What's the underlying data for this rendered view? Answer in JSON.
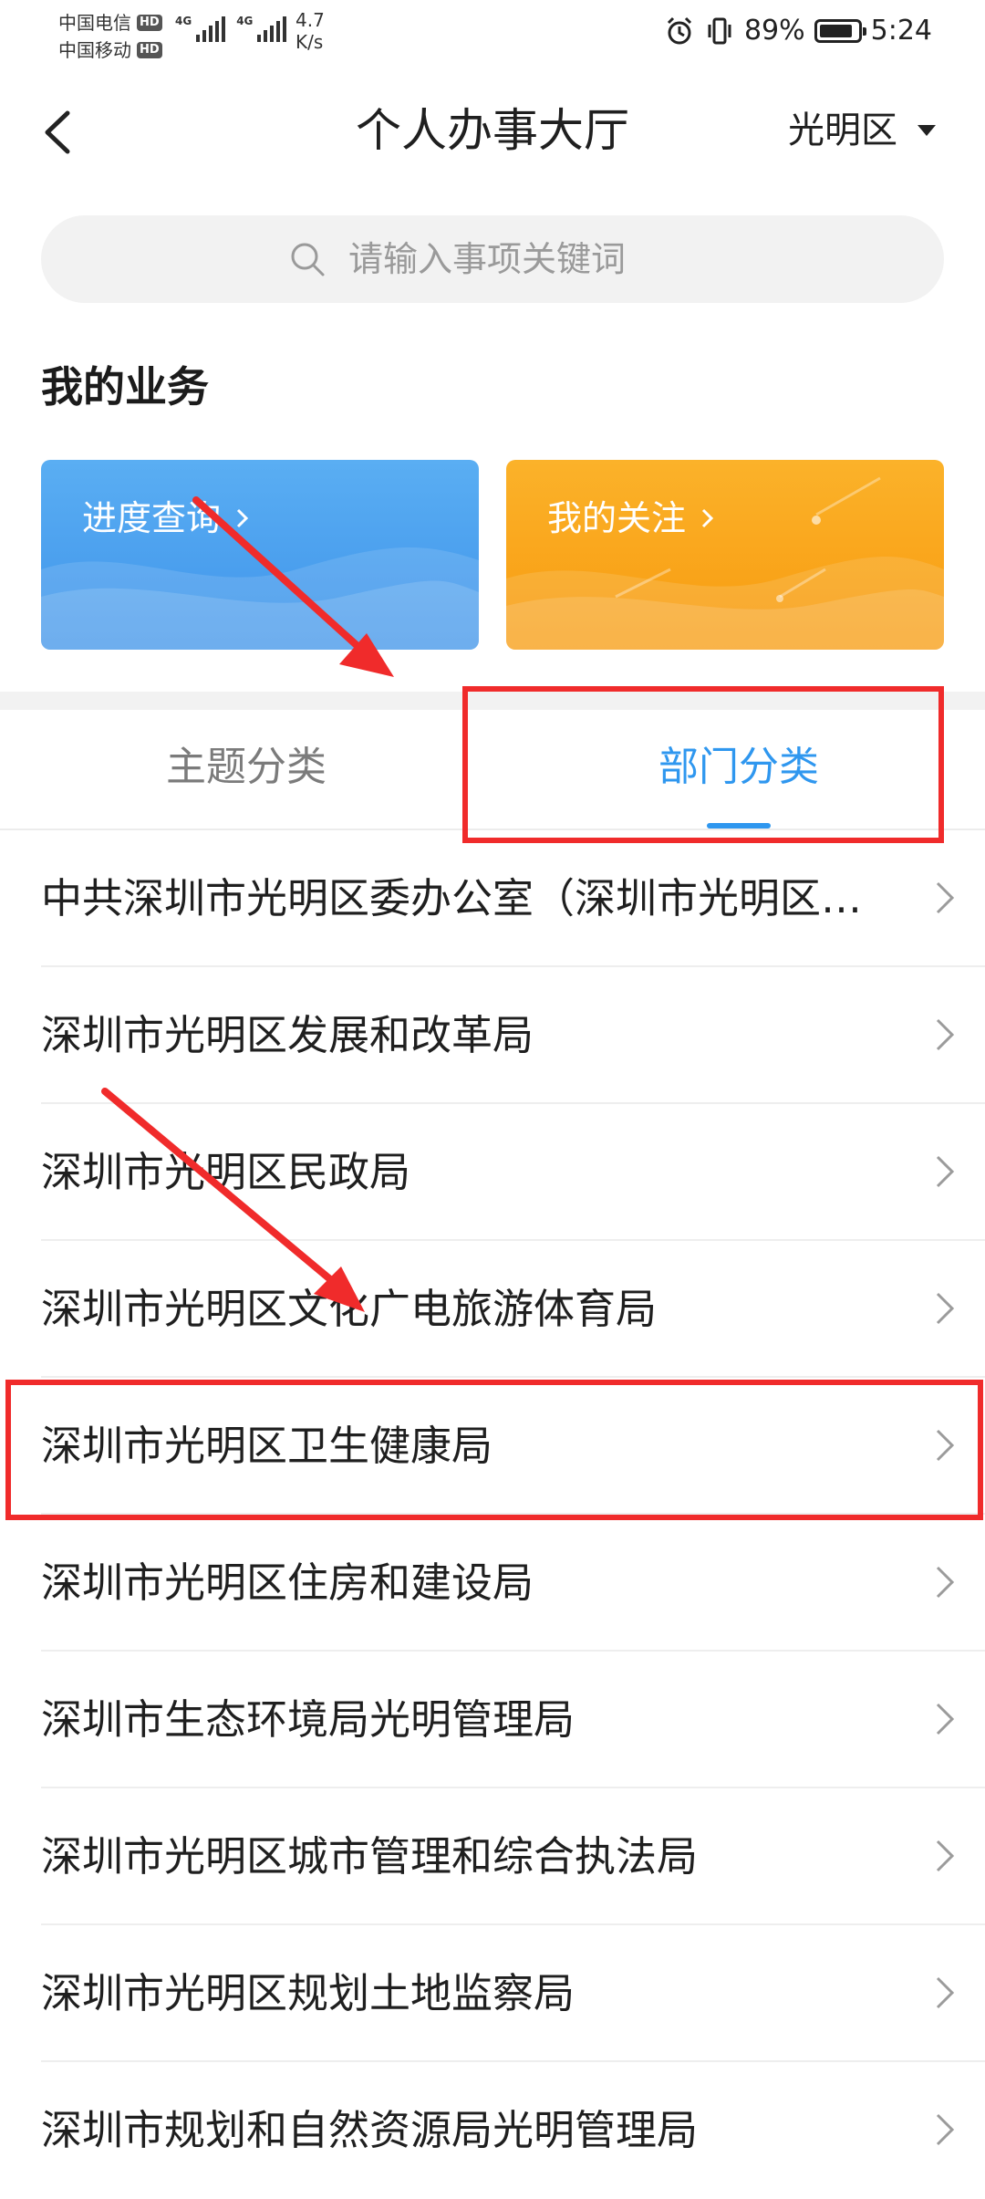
{
  "status_bar": {
    "carrier1": "中国电信",
    "carrier2": "中国移动",
    "hd": "HD",
    "net_type": "4G",
    "speed_value": "4.7",
    "speed_unit": "K/s",
    "battery": "89%",
    "time": "5:24"
  },
  "header": {
    "title": "个人办事大厅",
    "district": "光明区"
  },
  "search": {
    "placeholder": "请输入事项关键词"
  },
  "my_business": {
    "title": "我的业务",
    "cards": [
      {
        "label": "进度查询",
        "color": "#4aa3ef"
      },
      {
        "label": "我的关注",
        "color": "#f9a41b"
      }
    ]
  },
  "tabs": [
    {
      "label": "主题分类",
      "active": false
    },
    {
      "label": "部门分类",
      "active": true
    }
  ],
  "departments": [
    "中共深圳市光明区委办公室（深圳市光明区…",
    "深圳市光明区发展和改革局",
    "深圳市光明区民政局",
    "深圳市光明区文化广电旅游体育局",
    "深圳市光明区卫生健康局",
    "深圳市光明区住房和建设局",
    "深圳市生态环境局光明管理局",
    "深圳市光明区城市管理和综合执法局",
    "深圳市光明区规划土地监察局",
    "深圳市规划和自然资源局光明管理局"
  ],
  "colors": {
    "accent": "#2f97ef",
    "annotation": "#f02b2b"
  }
}
